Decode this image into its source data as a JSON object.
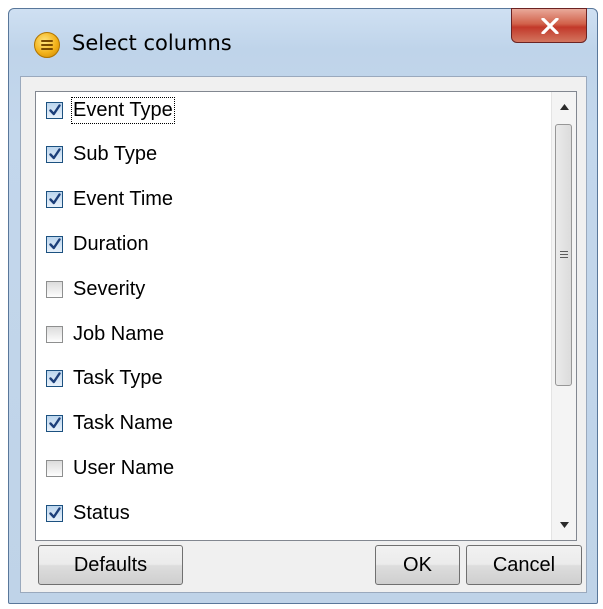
{
  "window": {
    "title": "Select columns",
    "close_label": "X"
  },
  "columns": [
    {
      "label": "Event Type",
      "checked": true,
      "focused": true
    },
    {
      "label": "Sub Type",
      "checked": true
    },
    {
      "label": "Event Time",
      "checked": true
    },
    {
      "label": "Duration",
      "checked": true
    },
    {
      "label": "Severity",
      "checked": false
    },
    {
      "label": "Job Name",
      "checked": false
    },
    {
      "label": "Task Type",
      "checked": true
    },
    {
      "label": "Task Name",
      "checked": true
    },
    {
      "label": "User Name",
      "checked": false
    },
    {
      "label": "Status",
      "checked": true
    }
  ],
  "buttons": {
    "defaults": "Defaults",
    "ok": "OK",
    "cancel": "Cancel"
  }
}
